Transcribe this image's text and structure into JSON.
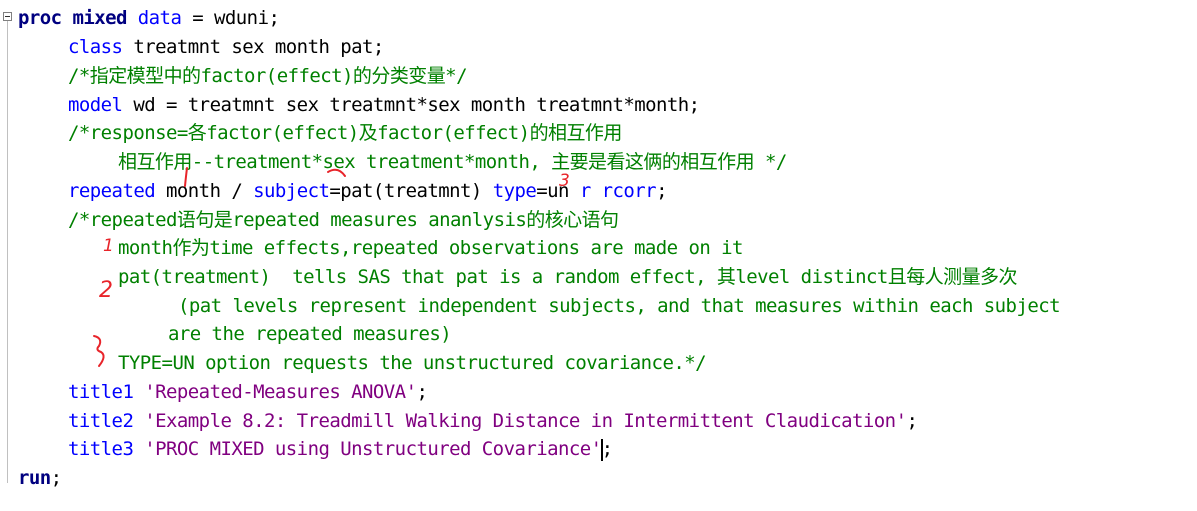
{
  "code": {
    "l1": {
      "kw": "proc mixed",
      "kw2": "data",
      "rest": " = wduni;"
    },
    "l2": {
      "kw": "class",
      "rest": " treatmnt sex month pat;"
    },
    "l3": {
      "comment": "/*指定模型中的factor(effect)的分类变量*/"
    },
    "l4": {
      "kw": "model",
      "rest": " wd = treatmnt sex treatmnt*sex month treatmnt*month;"
    },
    "l5": {
      "comment": "/*response=各factor(effect)及factor(effect)的相互作用"
    },
    "l6": {
      "comment": "相互作用--treatment*sex treatment*month, 主要是看这俩的相互作用 */"
    },
    "l7": {
      "kw": "repeated",
      "mid1": " month / ",
      "kw2": "subject",
      "mid2": "=pat(treatmnt) ",
      "kw3": "type",
      "mid3": "=un ",
      "kw4": "r",
      "sp": " ",
      "kw5": "rcorr",
      "end": ";"
    },
    "l8": {
      "comment": "/*repeated语句是repeated measures ananlysis的核心语句"
    },
    "l9": {
      "comment": "month作为time effects,repeated observations are made on it"
    },
    "l10": {
      "comment": "pat(treatment)  tells SAS that pat is a random effect, 其level distinct且每人测量多次"
    },
    "l11": {
      "comment": "(pat levels represent independent subjects, and that measures within each subject"
    },
    "l12": {
      "comment": "are the repeated measures)"
    },
    "l13": {
      "comment": "TYPE=UN option requests the unstructured covariance.*/"
    },
    "l14": {
      "kw": "title1",
      "str": " 'Repeated-Measures ANOVA'",
      "end": ";"
    },
    "l15": {
      "kw": "title2",
      "str": " 'Example 8.2: Treadmill Walking Distance in Intermittent Claudication'",
      "end": ";"
    },
    "l16": {
      "kw": "title3",
      "str": " 'PROC MIXED using Unstructured Covariance'",
      "end": ";"
    },
    "l17": {
      "kw": "run",
      "end": ";"
    }
  },
  "annotations": {
    "mark_1": "1",
    "mark_2": "2",
    "mark_3": "3",
    "color": "#e8242a"
  },
  "colors": {
    "keyword": "#000080",
    "statement": "#0000ff",
    "comment": "#008000",
    "string": "#800080"
  }
}
